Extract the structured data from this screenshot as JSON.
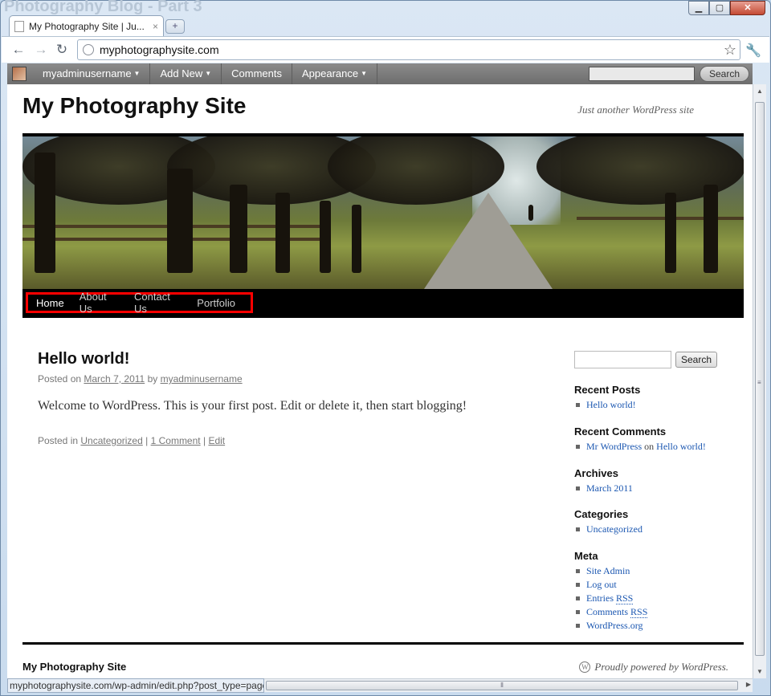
{
  "browser": {
    "background_title": "Photography Blog - Part 3",
    "tab_title": "My Photography Site | Ju...",
    "tab_close": "×",
    "new_tab": "+",
    "url": "myphotographysite.com",
    "status_url": "myphotographysite.com/wp-admin/edit.php?post_type=page",
    "window_buttons": {
      "min": "▁",
      "max": "▢",
      "close": "✕"
    }
  },
  "adminbar": {
    "items": [
      {
        "label": "myadminusername",
        "caret": "▼"
      },
      {
        "label": "Add New",
        "caret": "▼"
      },
      {
        "label": "Comments",
        "caret": ""
      },
      {
        "label": "Appearance",
        "caret": "▼"
      }
    ],
    "search_button": "Search"
  },
  "site": {
    "title": "My Photography Site",
    "description": "Just another WordPress site"
  },
  "menu": {
    "items": [
      "Home",
      "About Us",
      "Contact Us",
      "Portfolio"
    ]
  },
  "post": {
    "title": "Hello world!",
    "meta_prefix": "Posted on",
    "date": "March 7, 2011",
    "by": "by",
    "author": "myadminusername",
    "body": "Welcome to WordPress. This is your first post. Edit or delete it, then start blogging!",
    "foot_prefix": "Posted in",
    "category": "Uncategorized",
    "sep": "|",
    "comments": "1 Comment",
    "edit": "Edit"
  },
  "sidebar": {
    "search_button": "Search",
    "recent_posts": {
      "title": "Recent Posts",
      "items": [
        "Hello world!"
      ]
    },
    "recent_comments": {
      "title": "Recent Comments",
      "author": "Mr WordPress",
      "on": "on",
      "post": "Hello world!"
    },
    "archives": {
      "title": "Archives",
      "items": [
        "March 2011"
      ]
    },
    "categories": {
      "title": "Categories",
      "items": [
        "Uncategorized"
      ]
    },
    "meta": {
      "title": "Meta",
      "site_admin": "Site Admin",
      "log_out": "Log out",
      "entries": "Entries",
      "comments": "Comments",
      "rss": "RSS",
      "wordpress_org": "WordPress.org"
    }
  },
  "footer": {
    "title": "My Photography Site",
    "credit": "Proudly powered by WordPress."
  }
}
